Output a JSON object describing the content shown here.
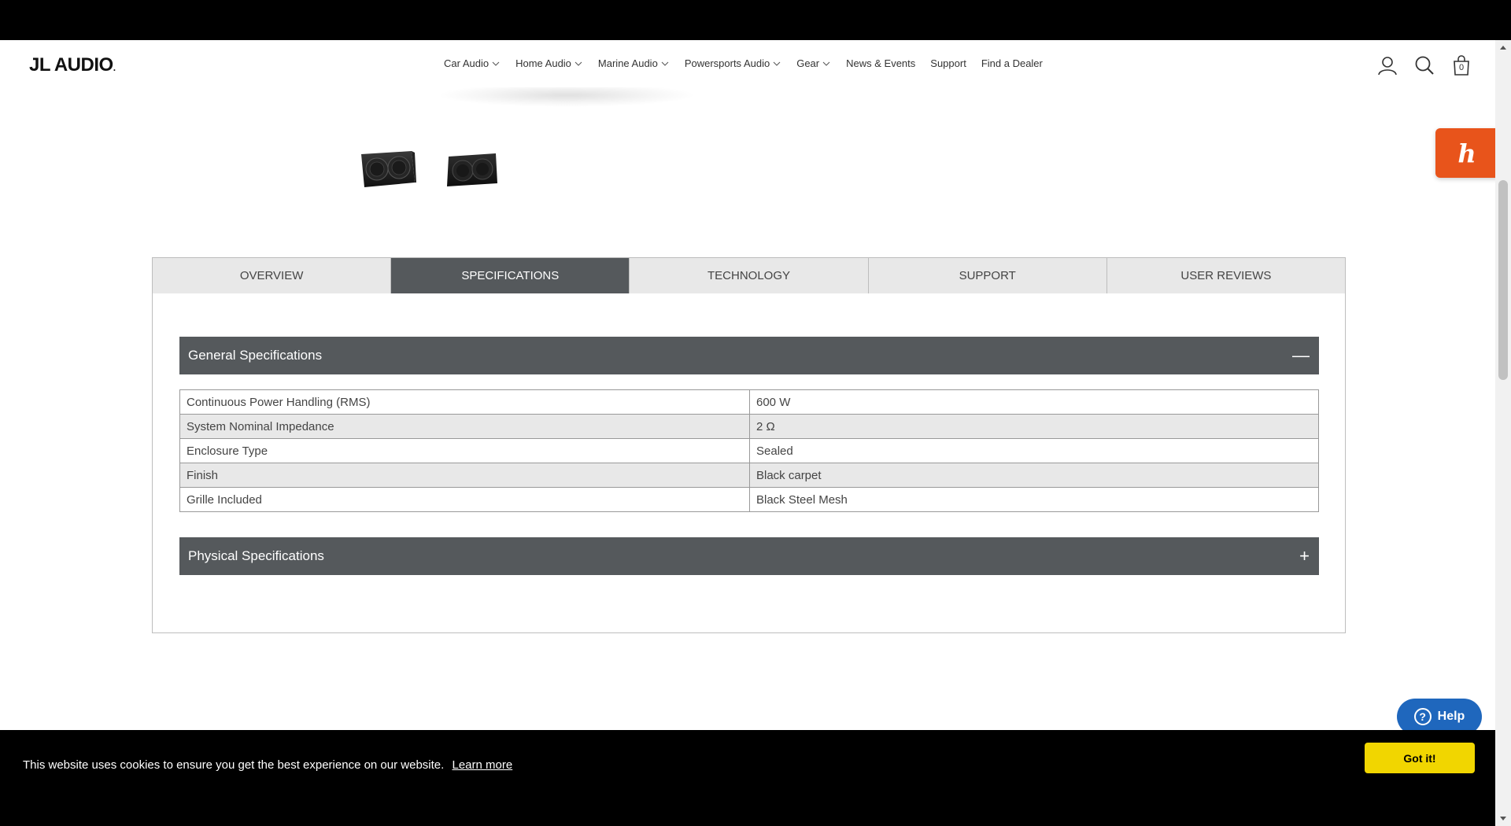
{
  "header": {
    "logo_text": "JL AUDIO",
    "nav": [
      {
        "label": "Car Audio",
        "has_dropdown": true
      },
      {
        "label": "Home Audio",
        "has_dropdown": true
      },
      {
        "label": "Marine Audio",
        "has_dropdown": true
      },
      {
        "label": "Powersports Audio",
        "has_dropdown": true
      },
      {
        "label": "Gear",
        "has_dropdown": true
      },
      {
        "label": "News & Events",
        "has_dropdown": false
      },
      {
        "label": "Support",
        "has_dropdown": false
      },
      {
        "label": "Find a Dealer",
        "has_dropdown": false
      }
    ],
    "cart_count": "0"
  },
  "tabs": [
    {
      "label": "OVERVIEW",
      "active": false
    },
    {
      "label": "SPECIFICATIONS",
      "active": true
    },
    {
      "label": "TECHNOLOGY",
      "active": false
    },
    {
      "label": "SUPPORT",
      "active": false
    },
    {
      "label": "USER REVIEWS",
      "active": false
    }
  ],
  "general_specs": {
    "title": "General Specifications",
    "toggle": "—",
    "rows": [
      {
        "label": "Continuous Power Handling (RMS)",
        "value": "600 W"
      },
      {
        "label": "System Nominal Impedance",
        "value": "2 Ω"
      },
      {
        "label": "Enclosure Type",
        "value": "Sealed"
      },
      {
        "label": "Finish",
        "value": "Black carpet"
      },
      {
        "label": "Grille Included",
        "value": "Black Steel Mesh"
      }
    ]
  },
  "physical_specs": {
    "title": "Physical Specifications",
    "toggle": "+"
  },
  "honey": {
    "glyph": "h"
  },
  "help": {
    "label": "Help"
  },
  "cookie": {
    "message": "This website uses cookies to ensure you get the best experience on our website.",
    "learn_more": "Learn more",
    "accept": "Got it!"
  },
  "colors": {
    "tab_active": "#55595c",
    "accordion": "#55595c",
    "honey": "#e8541b",
    "help": "#1f67bd",
    "cookie_button": "#f1d600"
  }
}
